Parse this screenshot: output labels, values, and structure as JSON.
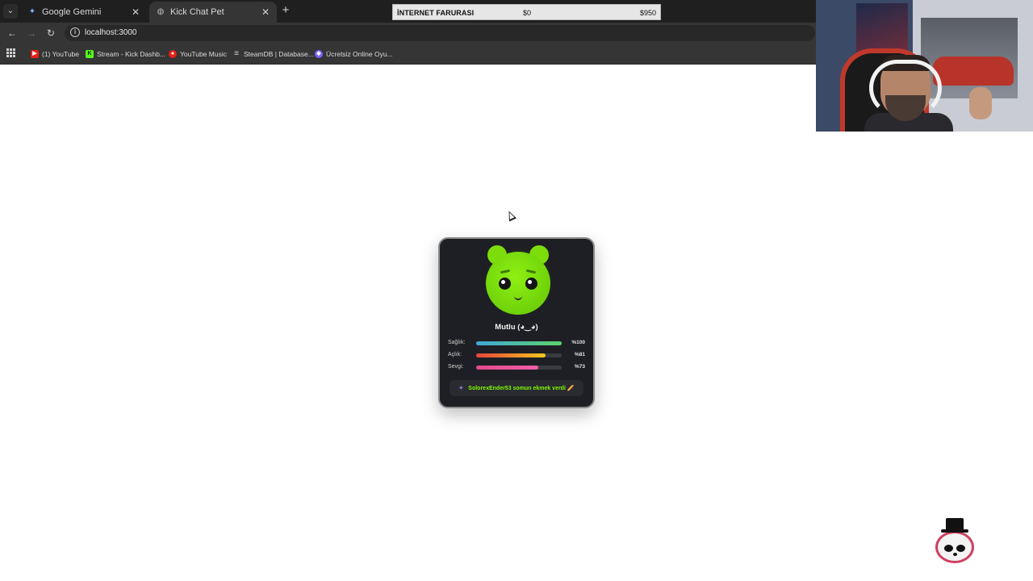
{
  "browser": {
    "tabs": [
      {
        "title": "Google Gemini",
        "icon": "gemini-icon",
        "active": false
      },
      {
        "title": "Kick Chat Pet",
        "icon": "globe-icon",
        "active": true
      }
    ],
    "address": "localhost:3000",
    "bookmarks": [
      {
        "label": "(1) YouTube",
        "icon": "youtube-icon",
        "color": "#e62117"
      },
      {
        "label": "Stream - Kick Dashb...",
        "icon": "kick-icon",
        "color": "#53fc18"
      },
      {
        "label": "YouTube Music",
        "icon": "youtube-music-icon",
        "color": "#e62117"
      },
      {
        "label": "SteamDB | Database...",
        "icon": "steamdb-icon",
        "color": "#cfcfcf"
      },
      {
        "label": "Ücretsiz Online Oyu...",
        "icon": "game-icon",
        "color": "#7b61ff"
      }
    ]
  },
  "overlay": {
    "label": "İNTERNET FARURASI",
    "value1": "$0",
    "value2": "$950"
  },
  "pet": {
    "mood": "Mutlu (◕‿◕)",
    "color": "#76e00e",
    "stats": [
      {
        "label": "Sağlık:",
        "value": "%100",
        "level": 100,
        "gradient": "linear-gradient(90deg, #3fa7d6, #5dd36b)"
      },
      {
        "label": "Açlık:",
        "value": "%81",
        "level": 81,
        "gradient": "linear-gradient(90deg, #e8443a, #f5c61c)"
      },
      {
        "label": "Sevgi:",
        "value": "%73",
        "level": 73,
        "gradient": "linear-gradient(90deg, #e34a8a, #f05fa8)"
      }
    ],
    "event": "SolorexEnder53 somun ekmek verdi 🥖",
    "event_icon": "sparkle-icon"
  }
}
